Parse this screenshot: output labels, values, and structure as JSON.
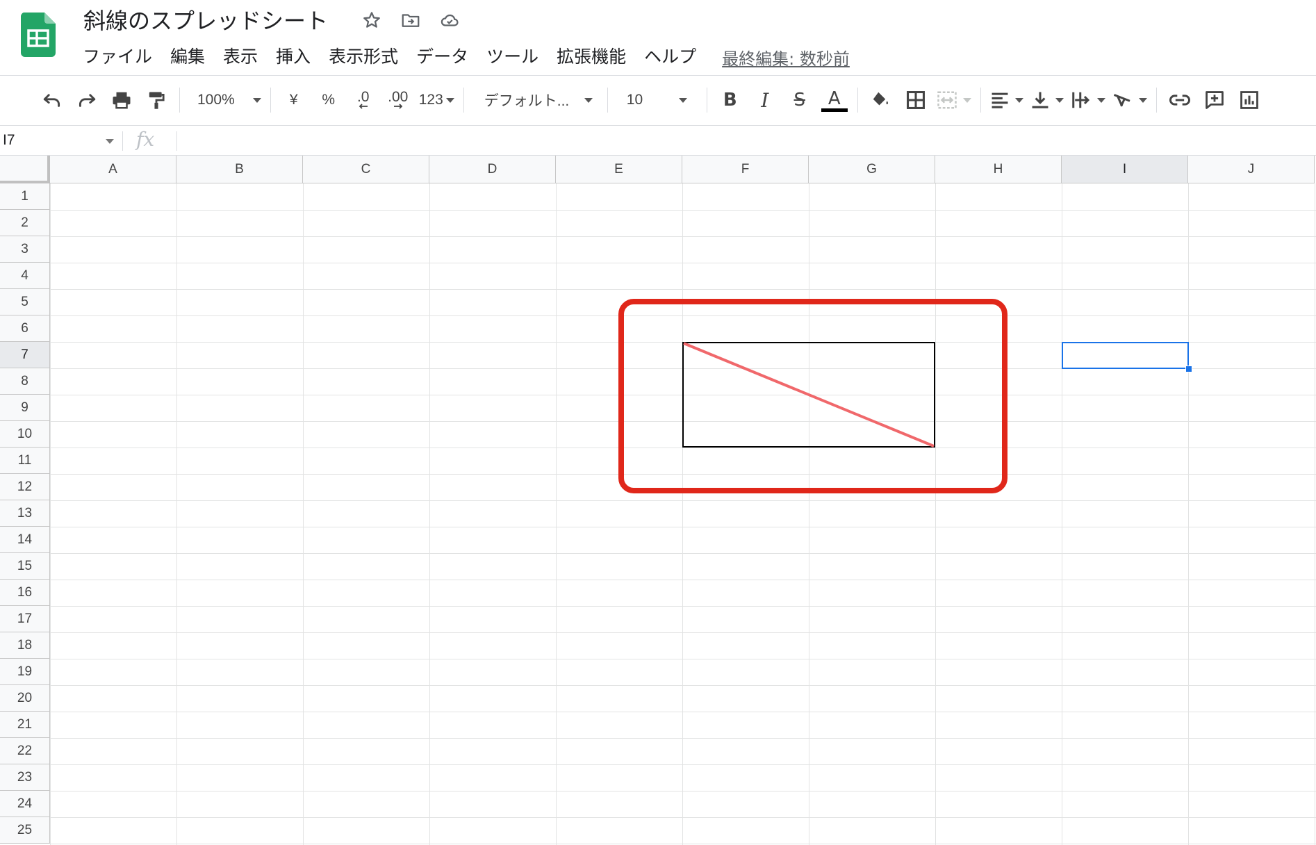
{
  "document": {
    "title": "斜線のスプレッドシート",
    "last_edit": "最終編集: 数秒前"
  },
  "menu": [
    "ファイル",
    "編集",
    "表示",
    "挿入",
    "表示形式",
    "データ",
    "ツール",
    "拡張機能",
    "ヘルプ"
  ],
  "toolbar": {
    "zoom": "100%",
    "currency": "¥",
    "percent": "%",
    "decimal_decrease": ".0",
    "decimal_increase": ".00",
    "number_format": "123",
    "font": "デフォルト...",
    "font_size": "10",
    "bold": "B",
    "italic": "I",
    "strikethrough": "S",
    "text_color": "A"
  },
  "formula_bar": {
    "name_box": "I7",
    "fx_label": "fx"
  },
  "grid": {
    "columns": [
      "A",
      "B",
      "C",
      "D",
      "E",
      "F",
      "G",
      "H",
      "I",
      "J"
    ],
    "rows": [
      "1",
      "2",
      "3",
      "4",
      "5",
      "6",
      "7",
      "8",
      "9",
      "10",
      "11",
      "12",
      "13",
      "14",
      "15",
      "16",
      "17",
      "18",
      "19",
      "20",
      "21",
      "22",
      "23",
      "24",
      "25"
    ],
    "selected_cell": "I7",
    "selected_column": "I",
    "selected_row": "7",
    "bordered_range": "F7:G10",
    "diagonal_line_color": "#f0686b",
    "highlight_color": "#e0271a",
    "selection_color": "#1a73e8"
  }
}
